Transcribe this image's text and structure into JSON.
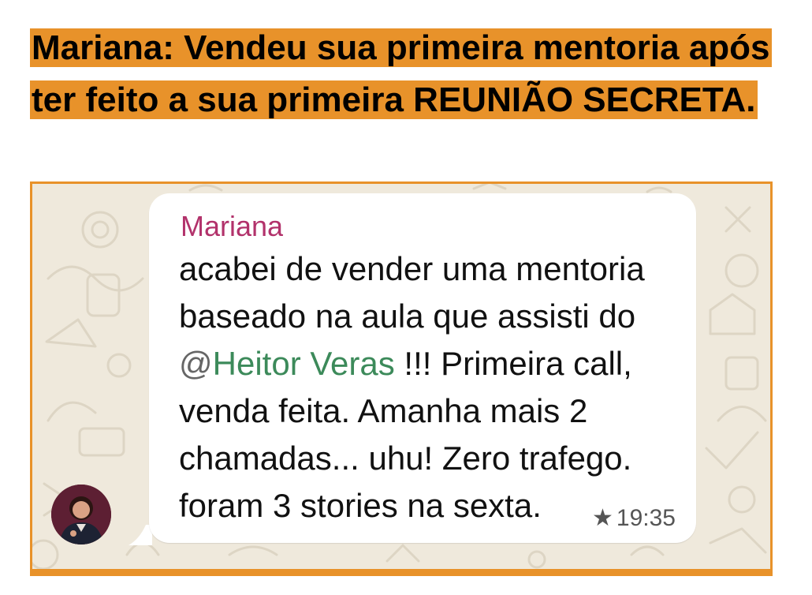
{
  "headline": {
    "text": "Mariana: Vendeu sua primeira mentoria após ter feito a sua primeira REUNIÃO SECRETA.",
    "highlight_color": "#E8922A"
  },
  "chat": {
    "wallpaper_color": "#efe9dc",
    "avatar_icon": "user-avatar-photo",
    "message": {
      "sender": "Mariana",
      "sender_color": "#b2326b",
      "text_before": "acabei de vender uma mentoria baseado na aula que assisti do ",
      "mention_at": "@",
      "mention_name": "Heitor Veras",
      "mention_color": "#3c8a5a",
      "text_after": " !!! Primeira call, venda feita. Amanha mais 2 chamadas... uhu! Zero trafego. foram 3 stories na sexta.",
      "star_icon": "★",
      "time": "19:35"
    }
  }
}
